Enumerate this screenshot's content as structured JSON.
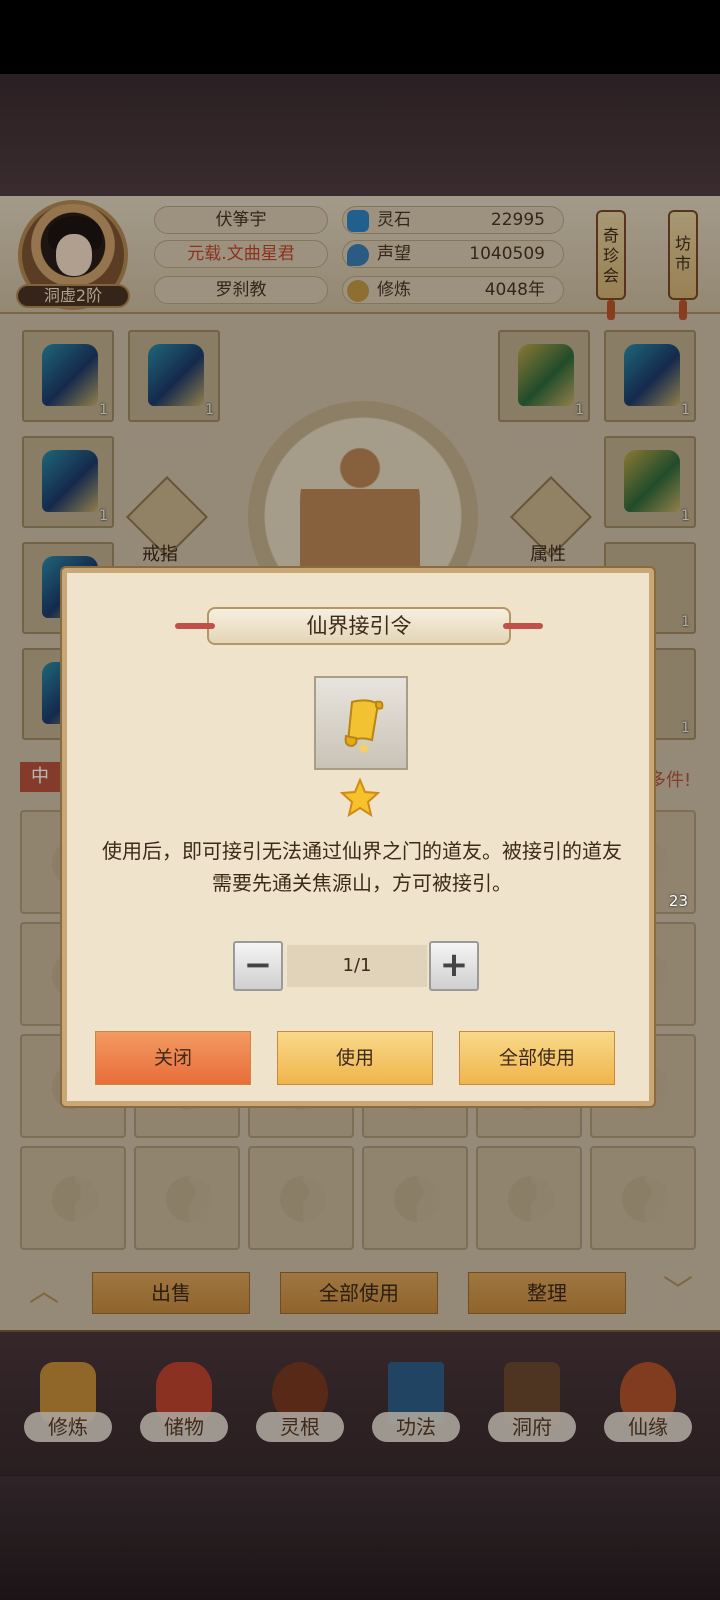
{
  "player": {
    "name": "伏筝宇",
    "title": "元载.文曲星君",
    "sect": "罗刹教",
    "rank": "洞虚2阶"
  },
  "stats": [
    {
      "label": "灵石",
      "value": "22995",
      "icon": "spirit-stone-icon",
      "color": "#2f86c4"
    },
    {
      "label": "声望",
      "value": "1040509",
      "icon": "reputation-icon",
      "color": "#3a7fb6"
    },
    {
      "label": "修炼",
      "value": "4048年",
      "icon": "cultivate-icon",
      "color": "#c49a46"
    }
  ],
  "lanterns": {
    "treasure": "奇珍会",
    "market": "坊市"
  },
  "equipment": {
    "ring_label": "戒指",
    "attr_label": "属性",
    "counts": [
      "1",
      "1",
      "1",
      "1",
      "1",
      "1",
      "1",
      "1",
      "1"
    ]
  },
  "bag": {
    "tab_label": "中",
    "more_text": "多件!",
    "item_count": "23",
    "sell_label": "出售",
    "use_all_label": "全部使用",
    "sort_label": "整理"
  },
  "nav": [
    {
      "label": "修炼",
      "icon": "cultivation-icon",
      "color": "#c98f3a"
    },
    {
      "label": "储物",
      "icon": "storage-bag-icon",
      "color": "#c0442e"
    },
    {
      "label": "灵根",
      "icon": "spirit-root-icon",
      "color": "#7a3a20"
    },
    {
      "label": "功法",
      "icon": "technique-book-icon",
      "color": "#2f5f88"
    },
    {
      "label": "洞府",
      "icon": "cave-dwelling-icon",
      "color": "#6b4a2e"
    },
    {
      "label": "仙缘",
      "icon": "fortune-gourd-icon",
      "color": "#b3532b"
    }
  ],
  "dialog": {
    "title": "仙界接引令",
    "description": "使用后，即可接引无法通过仙界之门的道友。被接引的道友需要先通关焦源山，方可被接引。",
    "quantity": "1/1",
    "close_label": "关闭",
    "use_label": "使用",
    "use_all_label": "全部使用",
    "item_icon": "golden-scroll-icon",
    "rarity_stars": 1
  }
}
